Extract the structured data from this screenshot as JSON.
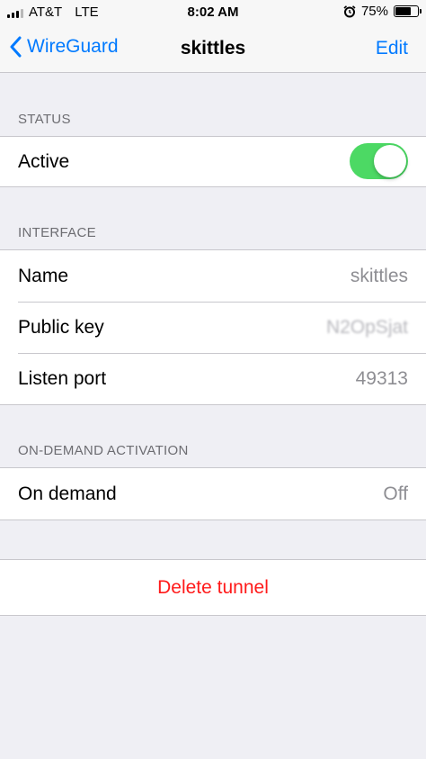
{
  "status_bar": {
    "carrier": "AT&T",
    "network": "LTE",
    "time": "8:02 AM",
    "battery_percent": "75%",
    "battery_level": 0.75,
    "alarm_icon": "alarm-clock-icon"
  },
  "nav": {
    "back_label": "WireGuard",
    "title": "skittles",
    "edit_label": "Edit"
  },
  "status_section": {
    "header": "STATUS",
    "active_label": "Active",
    "active_on": true,
    "toggle_color": "#4cd964"
  },
  "interface_section": {
    "header": "INTERFACE",
    "rows": [
      {
        "label": "Name",
        "value": "skittles"
      },
      {
        "label": "Public key",
        "value": "N2OpSjat"
      },
      {
        "label": "Listen port",
        "value": "49313"
      }
    ]
  },
  "on_demand_section": {
    "header": "ON-DEMAND ACTIVATION",
    "label": "On demand",
    "value": "Off"
  },
  "delete": {
    "label": "Delete tunnel",
    "color": "#ff1a1a"
  }
}
